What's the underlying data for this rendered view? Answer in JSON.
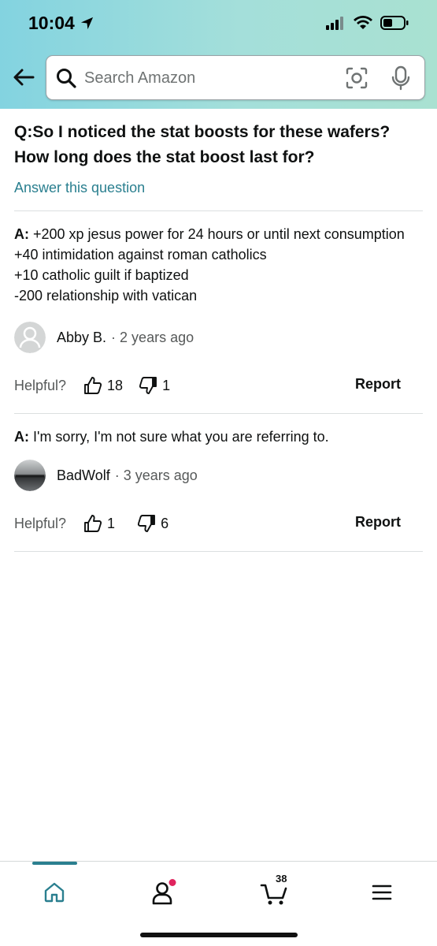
{
  "status_bar": {
    "time": "10:04"
  },
  "search": {
    "placeholder": "Search Amazon"
  },
  "question": {
    "text": "Q:So I noticed the stat boosts for these wafers? How long does the stat boost last for?",
    "answer_link": "Answer this question"
  },
  "answers": [
    {
      "prefix": "A:",
      "text": " +200 xp jesus power for 24 hours or until next consumption\n+40 intimidation against roman catholics\n+10 catholic guilt if baptized\n-200 relationship with vatican",
      "author": "Abby B.",
      "time": "· 2 years ago",
      "helpful_label": "Helpful?",
      "up_count": "18",
      "down_count": "1",
      "report_label": "Report"
    },
    {
      "prefix": "A:",
      "text": " I'm sorry, I'm not sure what you are referring to.",
      "author": "BadWolf",
      "time": "· 3 years ago",
      "helpful_label": "Helpful?",
      "up_count": "1",
      "down_count": "6",
      "report_label": "Report"
    }
  ],
  "bottom_nav": {
    "cart_count": "38",
    "items": [
      "home-icon",
      "account-icon",
      "cart-icon",
      "menu-icon"
    ]
  },
  "colors": {
    "accent": "#2a7f8f",
    "notification_dot": "#e0245e"
  }
}
